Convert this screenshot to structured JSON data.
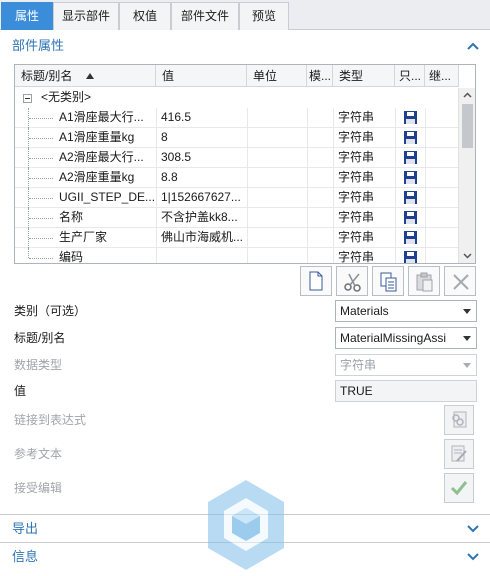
{
  "tabs": [
    {
      "label": "属性",
      "active": true
    },
    {
      "label": "显示部件",
      "active": false
    },
    {
      "label": "权值",
      "active": false
    },
    {
      "label": "部件文件",
      "active": false
    },
    {
      "label": "预览",
      "active": false
    }
  ],
  "part_properties": {
    "title": "部件属性",
    "columns": {
      "name": "标题/别名",
      "value": "值",
      "unit": "单位",
      "expr": "模...",
      "type": "类型",
      "readonly": "只...",
      "inherit": "继..."
    },
    "group_row": "<无类别>",
    "rows": [
      {
        "name": "A1滑座最大行...",
        "value": "416.5",
        "unit": "",
        "type": "字符串"
      },
      {
        "name": "A1滑座重量kg",
        "value": "8",
        "unit": "",
        "type": "字符串"
      },
      {
        "name": "A2滑座最大行...",
        "value": "308.5",
        "unit": "",
        "type": "字符串"
      },
      {
        "name": "A2滑座重量kg",
        "value": "8.8",
        "unit": "",
        "type": "字符串"
      },
      {
        "name": "UGII_STEP_DE...",
        "value": "1|152667627...",
        "unit": "",
        "type": "字符串"
      },
      {
        "name": "名称",
        "value": "不含护盖kk8...",
        "unit": "",
        "type": "字符串"
      },
      {
        "name": "生产厂家",
        "value": "佛山市海威机...",
        "unit": "",
        "type": "字符串"
      },
      {
        "name": "编码",
        "value": "",
        "unit": "",
        "type": "字符串"
      }
    ]
  },
  "toolbar": {
    "new": "new-document-icon",
    "cut": "scissors-icon",
    "copy": "copy-icon",
    "paste": "paste-icon",
    "delete": "delete-icon"
  },
  "form": {
    "category_label": "类别（可选）",
    "category_value": "Materials",
    "title_label": "标题/别名",
    "title_value": "MaterialMissingAssi",
    "datatype_label": "数据类型",
    "datatype_value": "字符串",
    "value_label": "值",
    "value_value": "TRUE",
    "link_label": "链接到表达式",
    "ref_label": "参考文本",
    "accept_label": "接受编辑"
  },
  "sections": {
    "export": "导出",
    "info": "信息"
  },
  "colors": {
    "accent": "#3c8dd9",
    "section_text": "#2e74b5",
    "floppy": "#1f3f8f"
  }
}
